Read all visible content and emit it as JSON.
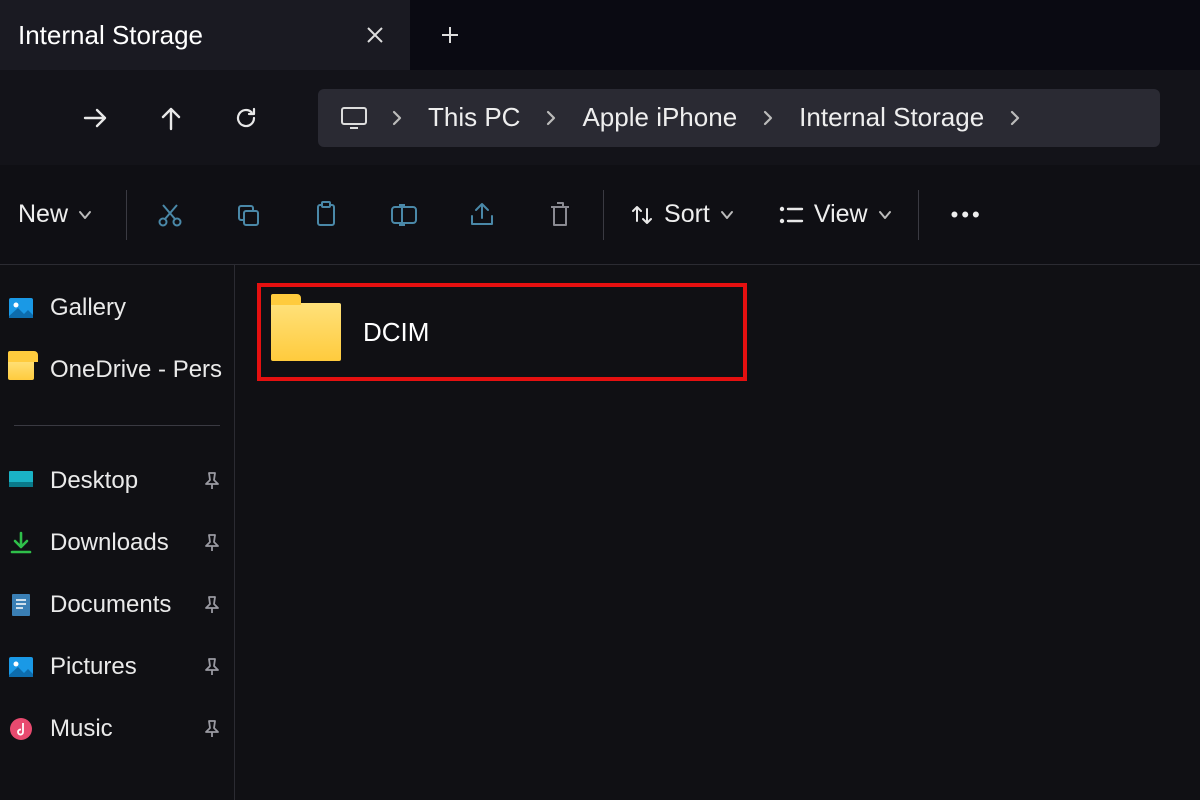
{
  "tabs": {
    "active_title": "Internal Storage"
  },
  "breadcrumb": {
    "items": [
      "This PC",
      "Apple iPhone",
      "Internal Storage"
    ]
  },
  "toolbar": {
    "new_label": "New",
    "sort_label": "Sort",
    "view_label": "View"
  },
  "sidebar": {
    "gallery": "Gallery",
    "onedrive": "OneDrive - Pers",
    "quick": [
      {
        "label": "Desktop"
      },
      {
        "label": "Downloads"
      },
      {
        "label": "Documents"
      },
      {
        "label": "Pictures"
      },
      {
        "label": "Music"
      }
    ]
  },
  "content": {
    "folders": [
      {
        "name": "DCIM"
      }
    ]
  },
  "colors": {
    "highlight_border": "#e51010",
    "folder_yellow": "#ffcb3d",
    "accent_blue": "#4a88a8"
  }
}
